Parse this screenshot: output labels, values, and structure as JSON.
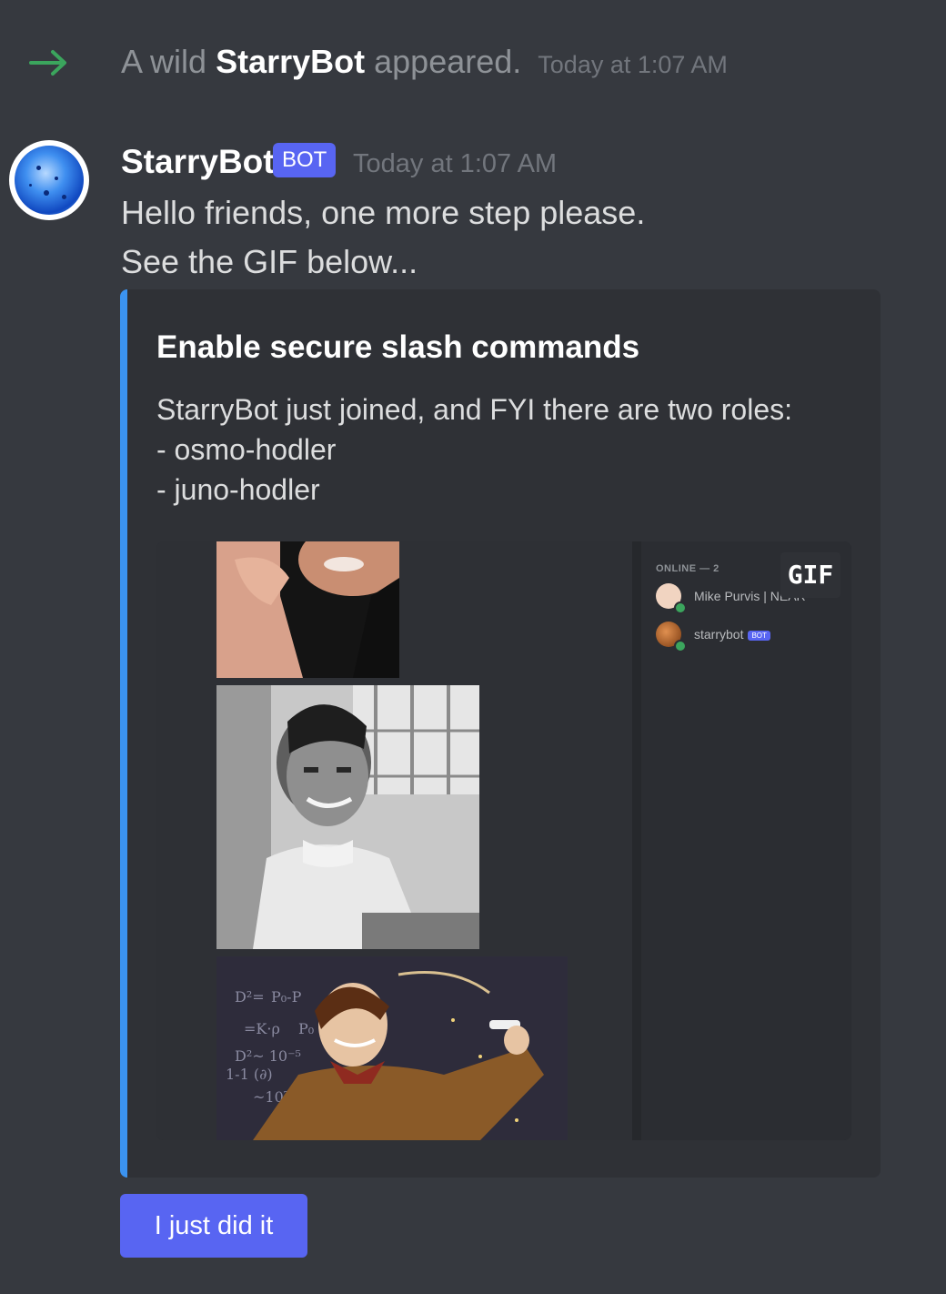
{
  "system_message": {
    "prefix": "A wild",
    "name": "StarryBot",
    "suffix": "appeared.",
    "timestamp": "Today at 1:07 AM"
  },
  "message": {
    "author": "StarryBot",
    "bot_tag": "BOT",
    "timestamp": "Today at 1:07 AM",
    "lines": [
      "Hello friends, one more step please.",
      "See the GIF below..."
    ]
  },
  "embed": {
    "title": "Enable secure slash commands",
    "description": [
      "StarryBot just joined, and FYI there are two roles:",
      "- osmo-hodler",
      "- juno-hodler"
    ],
    "accent_color": "#3b93f0",
    "gif": {
      "badge": "GIF",
      "member_list": {
        "header": "ONLINE — 2",
        "members": [
          {
            "name": "Mike Purvis | NEAR",
            "status": "online"
          },
          {
            "name": "starrybot",
            "tag": "BOT",
            "status": "online"
          }
        ]
      }
    }
  },
  "button": {
    "label": "I just did it",
    "color": "#5865f2"
  },
  "colors": {
    "background": "#36393f",
    "embed_bg": "#2f3136",
    "join_arrow": "#3ba55d"
  }
}
